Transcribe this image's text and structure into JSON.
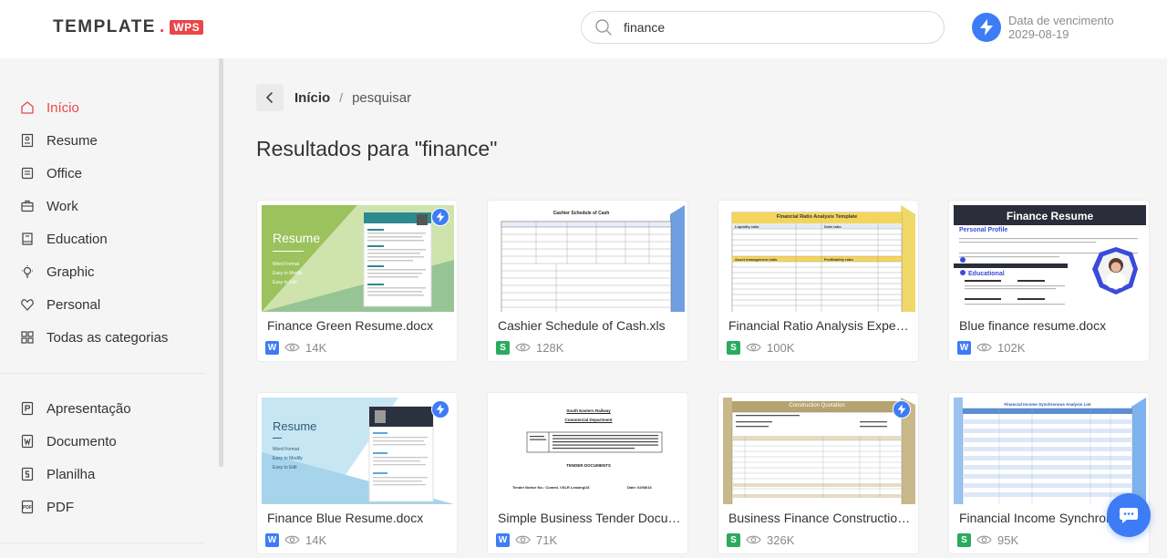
{
  "header": {
    "logo_main": "TEMPLATE",
    "logo_dot": ".",
    "logo_badge": "WPS",
    "search_value": "finance",
    "expiry_label": "Data de vencimento",
    "expiry_date": "2029-08-19"
  },
  "sidebar": {
    "items": [
      {
        "label": "Início",
        "icon": "home-icon",
        "active": true
      },
      {
        "label": "Resume",
        "icon": "resume-icon"
      },
      {
        "label": "Office",
        "icon": "office-icon"
      },
      {
        "label": "Work",
        "icon": "briefcase-icon"
      },
      {
        "label": "Education",
        "icon": "book-icon"
      },
      {
        "label": "Graphic",
        "icon": "bulb-icon"
      },
      {
        "label": "Personal",
        "icon": "heart-icon"
      },
      {
        "label": "Todas as categorias",
        "icon": "grid-icon"
      }
    ],
    "types": [
      {
        "label": "Apresentação",
        "icon": "presentation-icon"
      },
      {
        "label": "Documento",
        "icon": "document-icon"
      },
      {
        "label": "Planilha",
        "icon": "spreadsheet-icon"
      },
      {
        "label": "PDF",
        "icon": "pdf-icon"
      }
    ]
  },
  "breadcrumb": {
    "home": "Início",
    "separator": "/",
    "current": "pesquisar"
  },
  "results_title": "Resultados para \"finance\"",
  "cards": [
    {
      "name": "Finance Green Resume.docx",
      "type": "W",
      "views": "14K",
      "pro": true
    },
    {
      "name": "Cashier Schedule of Cash.xls",
      "type": "S",
      "views": "128K",
      "pro": false
    },
    {
      "name": "Financial Ratio Analysis Expense Report",
      "type": "S",
      "views": "100K",
      "pro": false
    },
    {
      "name": "Blue finance resume.docx",
      "type": "W",
      "views": "102K",
      "pro": false
    },
    {
      "name": "Finance Blue Resume.docx",
      "type": "W",
      "views": "14K",
      "pro": true
    },
    {
      "name": "Simple Business Tender Document.docx",
      "type": "W",
      "views": "71K",
      "pro": false
    },
    {
      "name": "Business Finance Construction Quotation.xls",
      "type": "S",
      "views": "326K",
      "pro": true
    },
    {
      "name": "Financial Income Synchronous Analysis List",
      "type": "S",
      "views": "95K",
      "pro": false
    }
  ],
  "thumbs": {
    "green_resume": {
      "title": "Resume",
      "bullets": [
        "Word Format",
        "Easy to Modify",
        "Easy to Edit"
      ]
    },
    "cashier": {
      "title": "Cashier Schedule of Cash"
    },
    "ratio": {
      "title": "Financial Ratio Analysis Template",
      "left_head": "Liquidity ratio",
      "right_head": "Debt ratio",
      "left_head2": "Asset management ratio",
      "right_head2": "Profitability ratio"
    },
    "blue_resume": {
      "title": "Finance Resume",
      "profile": "Personal Profile",
      "education": "Educational"
    },
    "blue_resume2": {
      "title": "Resume",
      "bullets": [
        "Word Format",
        "Easy to Modify",
        "Easy to Edit"
      ]
    },
    "tender": {
      "line1": "South Eastern Railway",
      "line2": "Commercial Department",
      "docs": "TENDER DOCUMENTS",
      "notice": "Tender Notice No.: Comml. VSLR Leasing/16",
      "date_label": "Date: 02/08/16"
    },
    "quotation": {
      "title": "Construction Quotation"
    },
    "income": {
      "title": "Financial Income Synchronous Analysis List"
    }
  },
  "colors": {
    "accent": "#e8474a",
    "blue": "#3d7cf5",
    "green": "#2aab5e"
  }
}
